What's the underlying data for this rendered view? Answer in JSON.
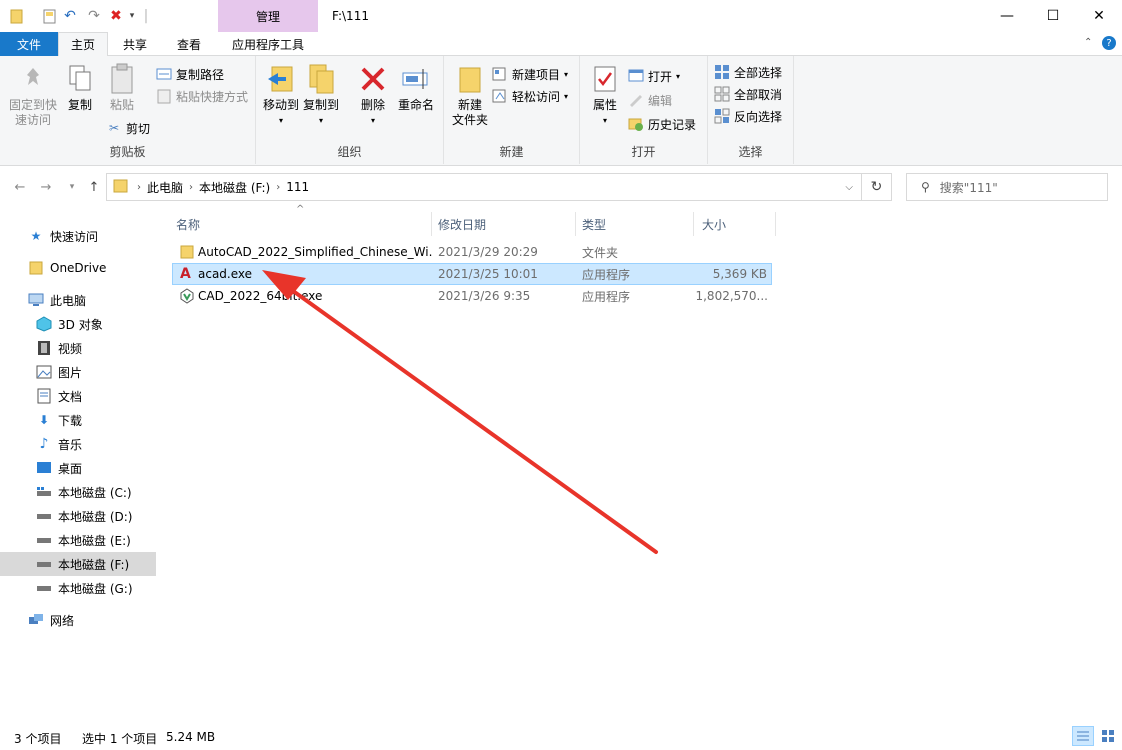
{
  "window": {
    "title": "F:\\111",
    "context_tab": "管理",
    "controls": {
      "minimize": "—",
      "maximize": "☐",
      "close": "✕"
    }
  },
  "ribbon_tabs": {
    "file": "文件",
    "home": "主页",
    "share": "共享",
    "view": "查看",
    "apptools": "应用程序工具"
  },
  "clipboard": {
    "label": "剪贴板",
    "pin": "固定到快\n速访问",
    "copy": "复制",
    "paste": "粘贴",
    "copy_path": "复制路径",
    "paste_shortcut": "粘贴快捷方式",
    "cut": "剪切"
  },
  "organize": {
    "label": "组织",
    "move_to": "移动到",
    "copy_to": "复制到",
    "delete": "删除",
    "rename": "重命名"
  },
  "new": {
    "label": "新建",
    "new_folder": "新建\n文件夹",
    "new_item": "新建项目",
    "easy_access": "轻松访问"
  },
  "open": {
    "label": "打开",
    "properties": "属性",
    "open": "打开",
    "edit": "编辑",
    "history": "历史记录"
  },
  "select": {
    "label": "选择",
    "select_all": "全部选择",
    "select_none": "全部取消",
    "invert": "反向选择"
  },
  "address": {
    "crumbs": [
      "此电脑",
      "本地磁盘 (F:)",
      "111"
    ]
  },
  "search": {
    "placeholder": "搜索\"111\""
  },
  "nav": {
    "quick_access": "快速访问",
    "onedrive": "OneDrive",
    "this_pc": "此电脑",
    "objects3d": "3D 对象",
    "videos": "视频",
    "pictures": "图片",
    "documents": "文档",
    "downloads": "下载",
    "music": "音乐",
    "desktop": "桌面",
    "drive_c": "本地磁盘 (C:)",
    "drive_d": "本地磁盘 (D:)",
    "drive_e": "本地磁盘 (E:)",
    "drive_f": "本地磁盘 (F:)",
    "drive_g": "本地磁盘 (G:)",
    "network": "网络"
  },
  "columns": {
    "name": "名称",
    "modified": "修改日期",
    "type": "类型",
    "size": "大小"
  },
  "files": [
    {
      "name": "AutoCAD_2022_Simplified_Chinese_Wi...",
      "modified": "2021/3/29 20:29",
      "type": "文件夹",
      "size": ""
    },
    {
      "name": "acad.exe",
      "modified": "2021/3/25 10:01",
      "type": "应用程序",
      "size": "5,369 KB"
    },
    {
      "name": "CAD_2022_64bit.exe",
      "modified": "2021/3/26 9:35",
      "type": "应用程序",
      "size": "1,802,570..."
    }
  ],
  "status": {
    "count": "3 个项目",
    "selected": "选中 1 个项目",
    "size": "5.24 MB"
  },
  "colors": {
    "accent": "#1979ca",
    "context_tab": "#e6c7ec",
    "selection": "#cce8ff",
    "arrow": "#e8342a"
  }
}
